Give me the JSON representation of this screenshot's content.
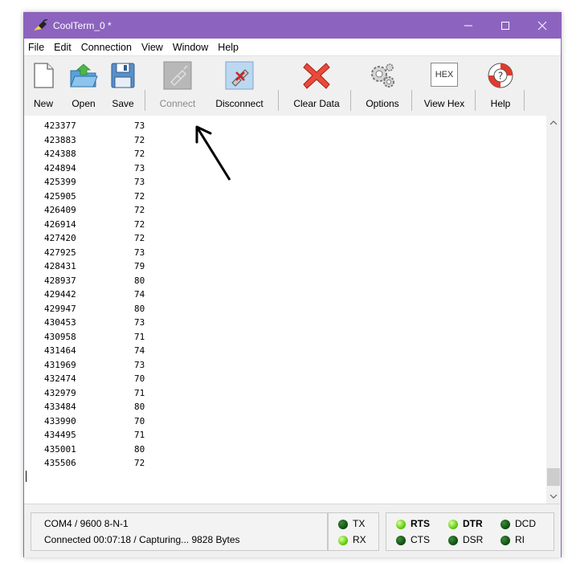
{
  "window": {
    "title": "CoolTerm_0 *"
  },
  "menu": [
    "File",
    "Edit",
    "Connection",
    "View",
    "Window",
    "Help"
  ],
  "toolbar": {
    "new": "New",
    "open": "Open",
    "save": "Save",
    "connect": "Connect",
    "disconnect": "Disconnect",
    "clear": "Clear Data",
    "options": "Options",
    "viewhex": "View Hex",
    "hex_badge": "HEX",
    "help": "Help"
  },
  "data_rows": [
    [
      "423377",
      "73"
    ],
    [
      "423883",
      "72"
    ],
    [
      "424388",
      "72"
    ],
    [
      "424894",
      "73"
    ],
    [
      "425399",
      "73"
    ],
    [
      "425905",
      "72"
    ],
    [
      "426409",
      "72"
    ],
    [
      "426914",
      "72"
    ],
    [
      "427420",
      "72"
    ],
    [
      "427925",
      "73"
    ],
    [
      "428431",
      "79"
    ],
    [
      "428937",
      "80"
    ],
    [
      "429442",
      "74"
    ],
    [
      "429947",
      "80"
    ],
    [
      "430453",
      "73"
    ],
    [
      "430958",
      "71"
    ],
    [
      "431464",
      "74"
    ],
    [
      "431969",
      "73"
    ],
    [
      "432474",
      "70"
    ],
    [
      "432979",
      "71"
    ],
    [
      "433484",
      "80"
    ],
    [
      "433990",
      "70"
    ],
    [
      "434495",
      "71"
    ],
    [
      "435001",
      "80"
    ],
    [
      "435506",
      "72"
    ]
  ],
  "status": {
    "port": "COM4 / 9600 8-N-1",
    "connection": "Connected 00:07:18 / Capturing... 9828 Bytes"
  },
  "indicators": {
    "tx": "TX",
    "rx": "RX",
    "rts": "RTS",
    "cts": "CTS",
    "dtr": "DTR",
    "dsr": "DSR",
    "dcd": "DCD",
    "ri": "RI"
  },
  "colors": {
    "titlebar": "#8c64bf",
    "led_on": "#53c400",
    "led_off": "#0d4a0d"
  }
}
